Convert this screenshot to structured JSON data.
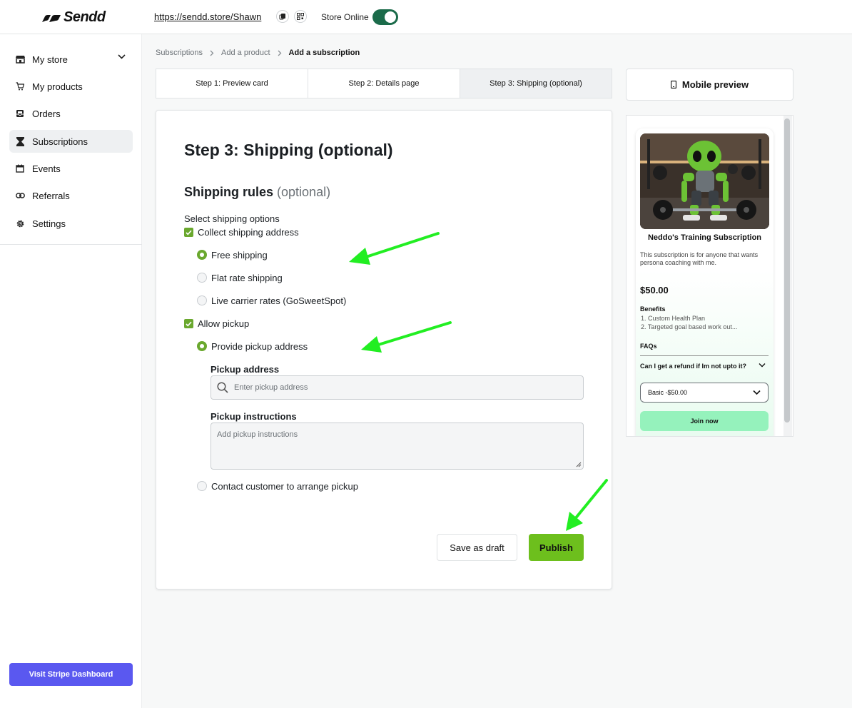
{
  "brand": {
    "name": "Sendd"
  },
  "topbar": {
    "store_url": "https://sendd.store/Shawn",
    "store_online_label": "Store Online",
    "store_online": true,
    "copy_icon": "copy-icon",
    "qr_icon": "qr-code-icon"
  },
  "sidebar": {
    "items": [
      {
        "label": "My store",
        "icon": "store-icon",
        "has_chevron": true
      },
      {
        "label": "My products",
        "icon": "cart-icon"
      },
      {
        "label": "Orders",
        "icon": "inbox-icon"
      },
      {
        "label": "Subscriptions",
        "icon": "hourglass-icon",
        "active": true
      },
      {
        "label": "Events",
        "icon": "calendar-icon"
      },
      {
        "label": "Referrals",
        "icon": "link-icon"
      },
      {
        "label": "Settings",
        "icon": "gear-icon"
      }
    ],
    "stripe_button": "Visit Stripe Dashboard",
    "stripe_color": "#5a58f0"
  },
  "breadcrumb": {
    "items": [
      "Subscriptions",
      "Add a product",
      "Add a subscription"
    ]
  },
  "tabs": [
    "Step 1: Preview card",
    "Step 2: Details page",
    "Step 3: Shipping (optional)"
  ],
  "form": {
    "title": "Step 3: Shipping (optional)",
    "section_title": "Shipping rules",
    "section_optional": "(optional)",
    "select_label": "Select shipping options",
    "collect_shipping": {
      "label": "Collect shipping address",
      "checked": true
    },
    "shipping_options": [
      {
        "label": "Free shipping",
        "selected": true
      },
      {
        "label": "Flat rate shipping",
        "selected": false
      },
      {
        "label": "Live carrier rates (GoSweetSpot)",
        "selected": false
      }
    ],
    "allow_pickup": {
      "label": "Allow pickup",
      "checked": true
    },
    "pickup_provide": {
      "label": "Provide pickup address",
      "selected": true
    },
    "pickup_address_label": "Pickup address",
    "pickup_address_placeholder": "Enter pickup address",
    "pickup_instructions_label": "Pickup instructions",
    "pickup_instructions_placeholder": "Add pickup instructions",
    "pickup_contact": {
      "label": "Contact customer to arrange pickup",
      "selected": false
    },
    "save_draft": "Save as draft",
    "publish": "Publish",
    "accent_color": "#6aa82e",
    "publish_color": "#6dbf1d"
  },
  "preview": {
    "mobile_button": "Mobile preview",
    "card_title": "Neddo's Training Subscription",
    "description": "This subscription is for anyone that wants persona coaching with me.",
    "price": "$50.00",
    "benefits_title": "Benefits",
    "benefits": [
      "1. Custom Health Plan",
      "2. Targeted goal based work out..."
    ],
    "faqs_title": "FAQs",
    "faq_question": "Can I get a refund if Im not upto it?",
    "plan_select": "Basic -$50.00",
    "join_button": "Join now",
    "join_color": "#95f2bc"
  },
  "annotations": {
    "arrow_color": "#22ee22"
  }
}
